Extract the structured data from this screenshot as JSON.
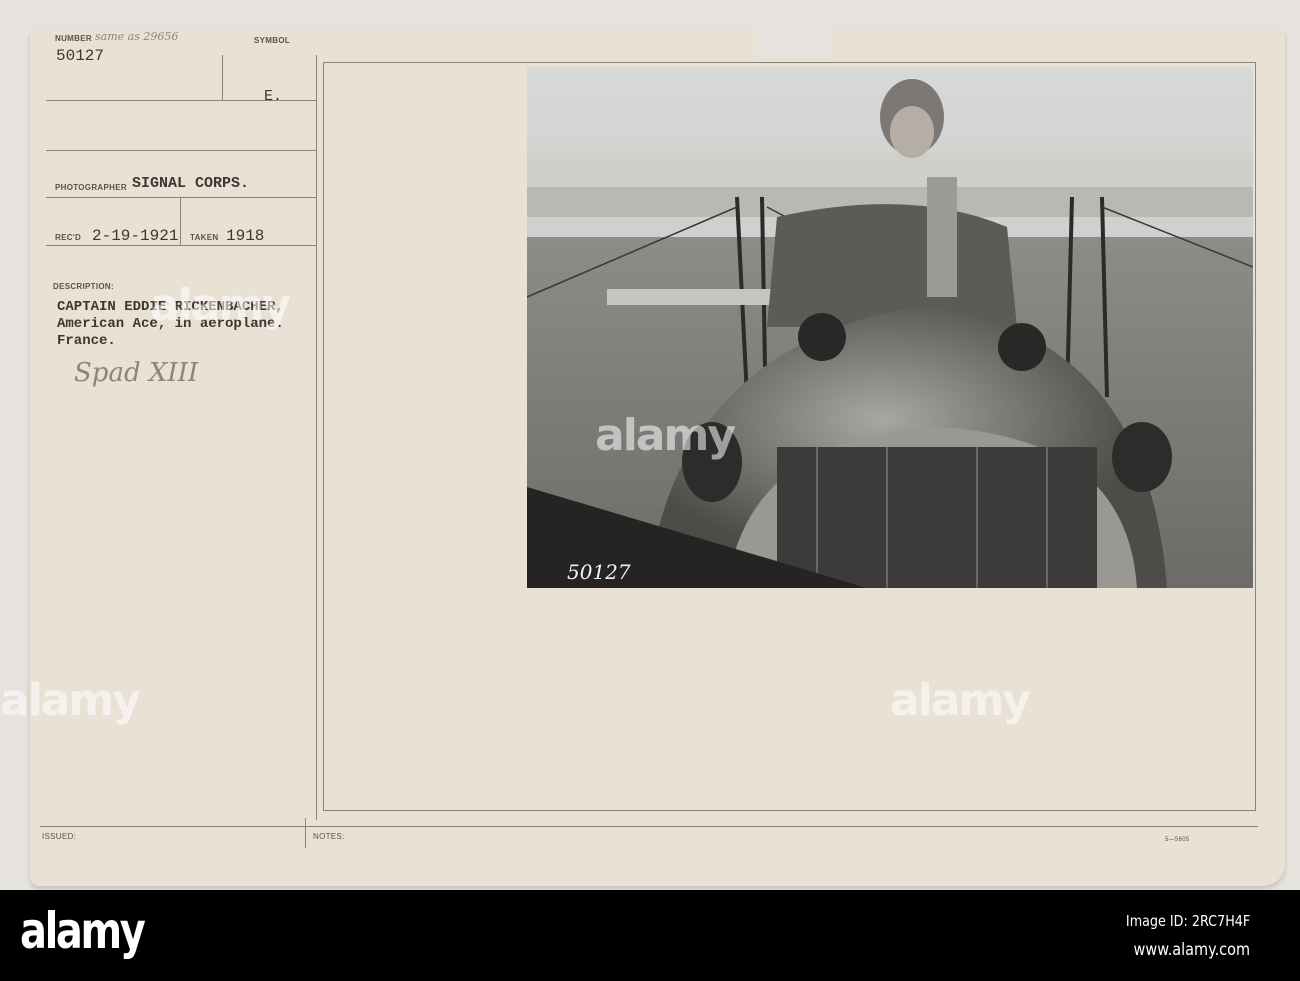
{
  "card": {
    "number_label": "NUMBER",
    "number_note": "same as 29656",
    "number": "50127",
    "symbol_label": "SYMBOL",
    "symbol": "E.",
    "photographer_label": "PHOTOGRAPHER",
    "photographer": "SIGNAL CORPS.",
    "recd_label": "REC'D",
    "recd": "2-19-1921",
    "taken_label": "TAKEN",
    "taken": "1918",
    "description_label": "DESCRIPTION:",
    "description": [
      "CAPTAIN EDDIE RICKENBACHER,",
      "American Ace, in aeroplane.",
      "France."
    ],
    "handwritten_note": "Spad XIII",
    "issued_label": "ISSUED:",
    "notes_label": "NOTES:",
    "form_number": "5—5605"
  },
  "photo": {
    "caption_number": "50127"
  },
  "watermark": "alamy",
  "footer": {
    "logo": "alamy",
    "image_id": "Image ID: 2RC7H4F",
    "url": "www.alamy.com"
  }
}
